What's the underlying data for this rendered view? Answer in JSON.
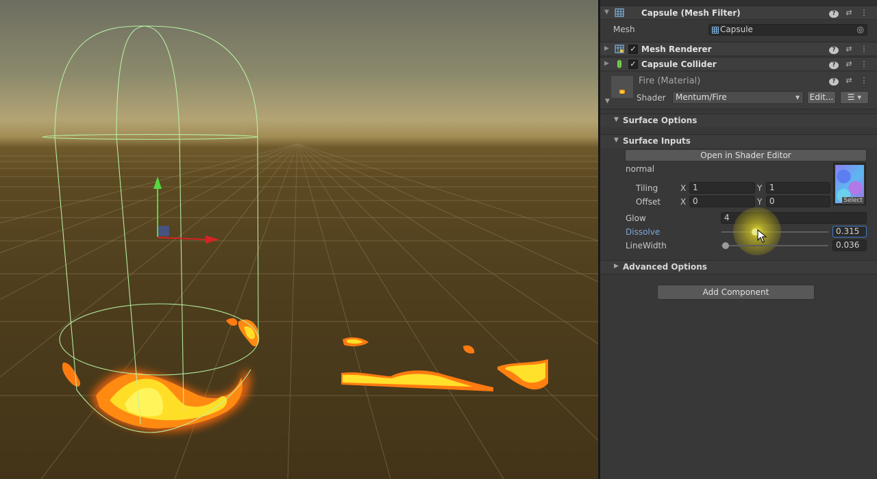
{
  "inspector": {
    "mesh_filter": {
      "title": "Capsule (Mesh Filter)",
      "mesh_label": "Mesh",
      "mesh_value": "Capsule"
    },
    "mesh_renderer": {
      "title": "Mesh Renderer",
      "enabled": true
    },
    "capsule_collider": {
      "title": "Capsule Collider",
      "enabled": true
    },
    "material": {
      "name": "Fire (Material)",
      "shader_label": "Shader",
      "shader_value": "Mentum/Fire",
      "edit_label": "Edit...",
      "menu_glyph": "☰"
    },
    "surface_options": {
      "title": "Surface Options"
    },
    "surface_inputs": {
      "title": "Surface Inputs",
      "open_editor_label": "Open in Shader Editor",
      "normal_label": "normal",
      "tiling_label": "Tiling",
      "offset_label": "Offset",
      "x_label": "X",
      "y_label": "Y",
      "tiling_x": "1",
      "tiling_y": "1",
      "offset_x": "0",
      "offset_y": "0",
      "texture_select_label": "Select",
      "glow_label": "Glow",
      "glow_value": "4",
      "dissolve_label": "Dissolve",
      "dissolve_value": "0.315",
      "dissolve_fraction": 0.315,
      "linewidth_label": "LineWidth",
      "linewidth_value": "0.036",
      "linewidth_fraction": 0.036
    },
    "advanced_options": {
      "title": "Advanced Options"
    },
    "add_component_label": "Add Component"
  },
  "icons": {
    "fold_collapsed": "▶",
    "fold_expanded": "▼",
    "help": "?",
    "presets": "⇄",
    "more": "⋮",
    "check": "✓",
    "dropdown": "▾",
    "target": "◎"
  },
  "colors": {
    "inspector_bg": "#383838",
    "header_bg": "#3e3e3e",
    "dissolve_label": "#7fa7dc",
    "field_focus": "#3d7fd0",
    "gizmo_y": "#56d83f",
    "gizmo_x": "#d42424",
    "gizmo_z": "#3a5fd0",
    "collider": "#b9f5a6",
    "fire_core": "#ffef3a",
    "fire_edge": "#ff7a10"
  }
}
